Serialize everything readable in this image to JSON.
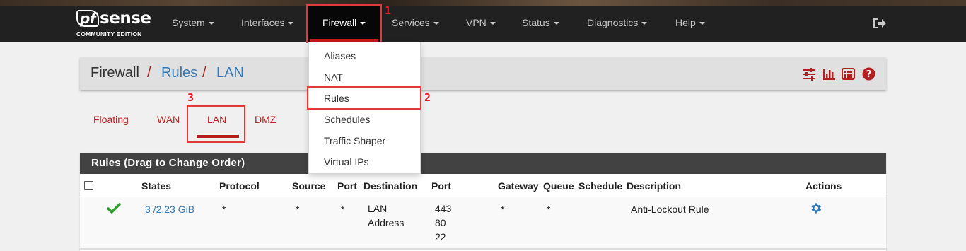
{
  "brand": {
    "logo_prefix": "pf",
    "logo_rest": "sense",
    "edition": "COMMUNITY EDITION"
  },
  "nav": {
    "items": [
      {
        "label": "System"
      },
      {
        "label": "Interfaces"
      },
      {
        "label": "Firewall"
      },
      {
        "label": "Services"
      },
      {
        "label": "VPN"
      },
      {
        "label": "Status"
      },
      {
        "label": "Diagnostics"
      },
      {
        "label": "Help"
      }
    ],
    "logout_icon": "sign-out-icon"
  },
  "annotations": {
    "n1": "1",
    "n2": "2",
    "n3": "3"
  },
  "firewall_menu": {
    "items": [
      {
        "label": "Aliases"
      },
      {
        "label": "NAT"
      },
      {
        "label": "Rules"
      },
      {
        "label": "Schedules"
      },
      {
        "label": "Traffic Shaper"
      },
      {
        "label": "Virtual IPs"
      }
    ]
  },
  "breadcrumb": {
    "root": "Firewall",
    "sep": "/",
    "rules": "Rules",
    "current": "LAN"
  },
  "header_icons": [
    "sliders-icon",
    "bar-chart-icon",
    "list-icon",
    "help-icon"
  ],
  "tabs": [
    {
      "label": "Floating"
    },
    {
      "label": "WAN"
    },
    {
      "label": "LAN",
      "active": true
    },
    {
      "label": "DMZ"
    }
  ],
  "rules_panel": {
    "title": "Rules (Drag to Change Order)",
    "columns": [
      "States",
      "Protocol",
      "Source",
      "Port",
      "Destination",
      "Port",
      "Gateway",
      "Queue",
      "Schedule",
      "Description",
      "Actions"
    ],
    "rows": [
      {
        "status_icon": "check-icon",
        "states": "3 /2.23 GiB",
        "protocol": "*",
        "source": "*",
        "source_port": "*",
        "destination": [
          "LAN",
          "Address"
        ],
        "dest_port": [
          "443",
          "80",
          "22"
        ],
        "gateway": "*",
        "queue": "*",
        "schedule": "",
        "description": "Anti-Lockout Rule",
        "action_icon": "gear-icon"
      }
    ]
  },
  "colors": {
    "accent": "#b21f1f",
    "link": "#337ab7",
    "navbar": "#212121",
    "panel_header": "#424242",
    "highlight": "#e03a3a",
    "check": "#2e9e2e"
  }
}
